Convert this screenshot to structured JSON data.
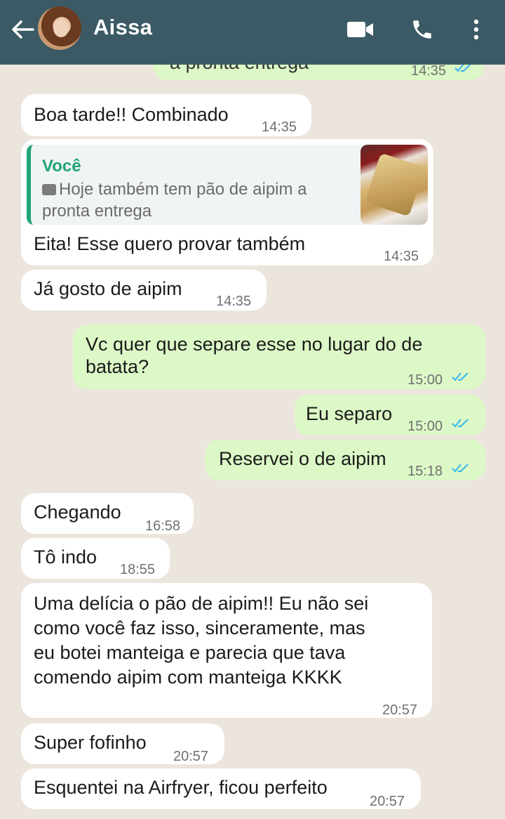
{
  "header": {
    "contact_name": "Aissa",
    "background": "#3c5a65",
    "icons": [
      "back-arrow-icon",
      "video-call-icon",
      "phone-icon",
      "more-vert-icon"
    ]
  },
  "colors": {
    "chat_background": "#ece5dd",
    "incoming_bubble": "#ffffff",
    "outgoing_bubble": "#dcf8c6",
    "quote_accent": "#1fa37a",
    "read_ticks": "#34b7f1"
  },
  "messages": [
    {
      "direction": "out",
      "text": "a pronta entrega",
      "time": "14:35",
      "status": "read"
    },
    {
      "direction": "in",
      "text": "Boa tarde!! Combinado",
      "time": "14:35"
    },
    {
      "direction": "in",
      "quote": {
        "author": "Você",
        "text_line1": "Hoje também tem pão de aipim a",
        "text_line2": "pronta entrega"
      },
      "text": "Eita! Esse quero provar também",
      "time": "14:35"
    },
    {
      "direction": "in",
      "text": "Já gosto de aipim",
      "time": "14:35"
    },
    {
      "direction": "out",
      "text_line1": "Vc quer que separe esse no lugar do de",
      "text_line2": "batata?",
      "time": "15:00",
      "status": "read"
    },
    {
      "direction": "out",
      "text": "Eu separo",
      "time": "15:00",
      "status": "read"
    },
    {
      "direction": "out",
      "text": "Reservei o de aipim",
      "time": "15:18",
      "status": "read"
    },
    {
      "direction": "in",
      "text": "Chegando",
      "time": "16:58"
    },
    {
      "direction": "in",
      "text": "Tô indo",
      "time": "18:55"
    },
    {
      "direction": "in",
      "text_line1": "Uma delícia o pão de aipim!! Eu não sei",
      "text_line2": "como você faz isso, sinceramente, mas",
      "text_line3": "eu botei manteiga e parecia que tava",
      "text_line4": "comendo aipim com manteiga KKKK",
      "time": "20:57"
    },
    {
      "direction": "in",
      "text": "Super fofinho",
      "time": "20:57"
    },
    {
      "direction": "in",
      "text": "Esquentei na Airfryer, ficou perfeito",
      "time": "20:57"
    }
  ]
}
